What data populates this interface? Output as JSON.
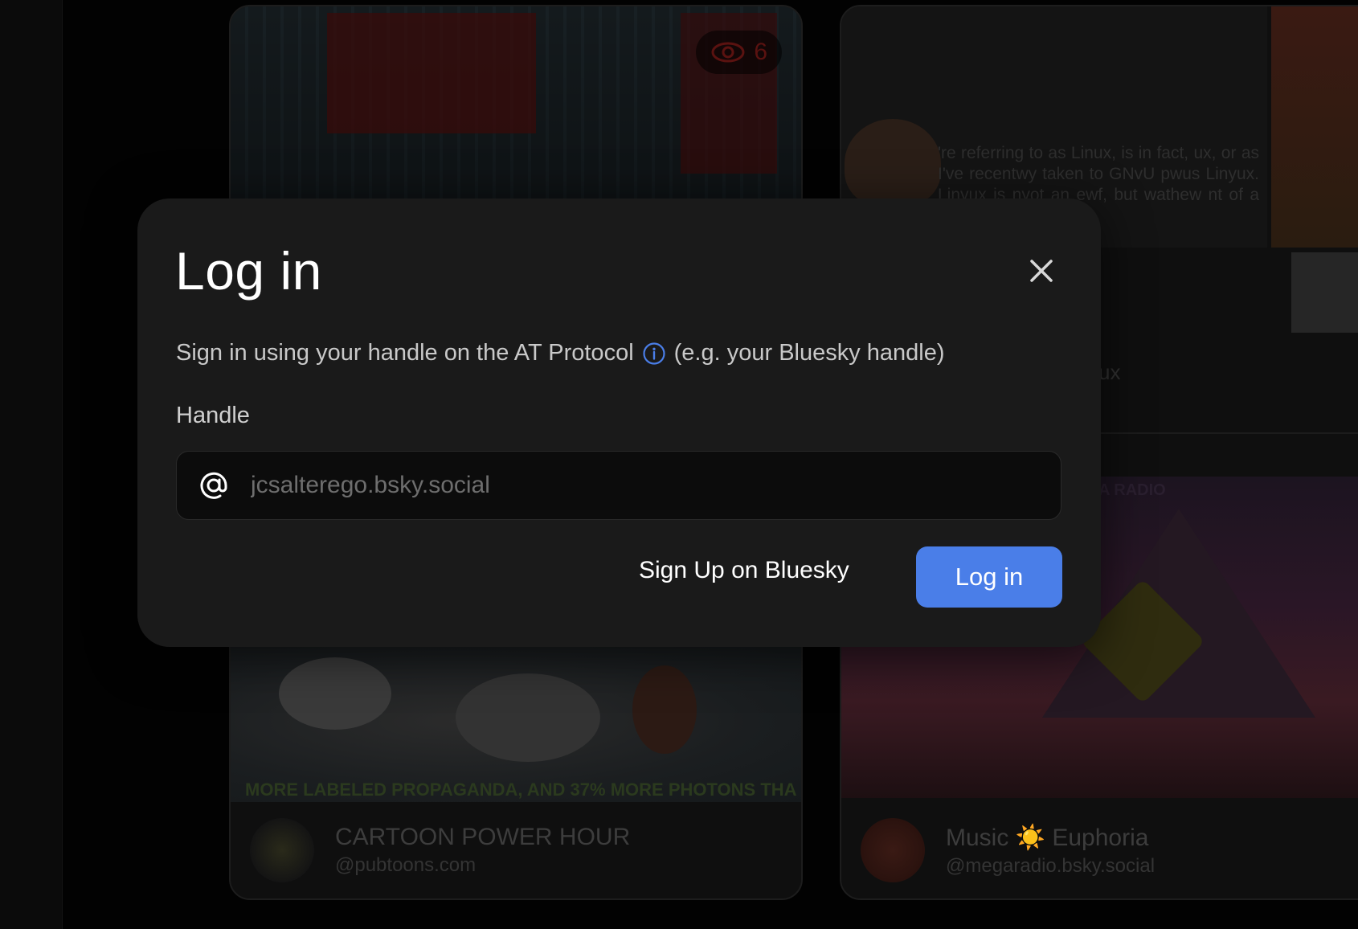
{
  "colors": {
    "modal_bg": "#1a1a1a",
    "accent": "#4a7ee8",
    "page_bg": "#020202"
  },
  "background": {
    "left_card_top": {
      "view_count": "6"
    },
    "left_card_bottom": {
      "caption": "MORE LABELED PROPAGANDA, AND 37% MORE PHOTONS THA",
      "name": "CARTOON POWER HOUR",
      "handle": "@pubtoons.com"
    },
    "right_card_top": {
      "text": "'re referring to as Linux, is in fact, ux, or as I've recentwy taken to GNvU pwus Linyux. Linyux is nyot an ewf, but wathew nt of a fuwwy",
      "label": "ux"
    },
    "right_card_bottom": {
      "banner": "A RADIO",
      "name": "Music ☀️ Euphoria",
      "handle": "@megaradio.bsky.social"
    }
  },
  "modal": {
    "title": "Log in",
    "description_before": "Sign in using your handle on the AT Protocol",
    "description_after": "(e.g. your Bluesky handle)",
    "handle_label": "Handle",
    "handle_placeholder": "jcsalterego.bsky.social",
    "signup_label": "Sign Up on Bluesky",
    "login_label": "Log in"
  }
}
